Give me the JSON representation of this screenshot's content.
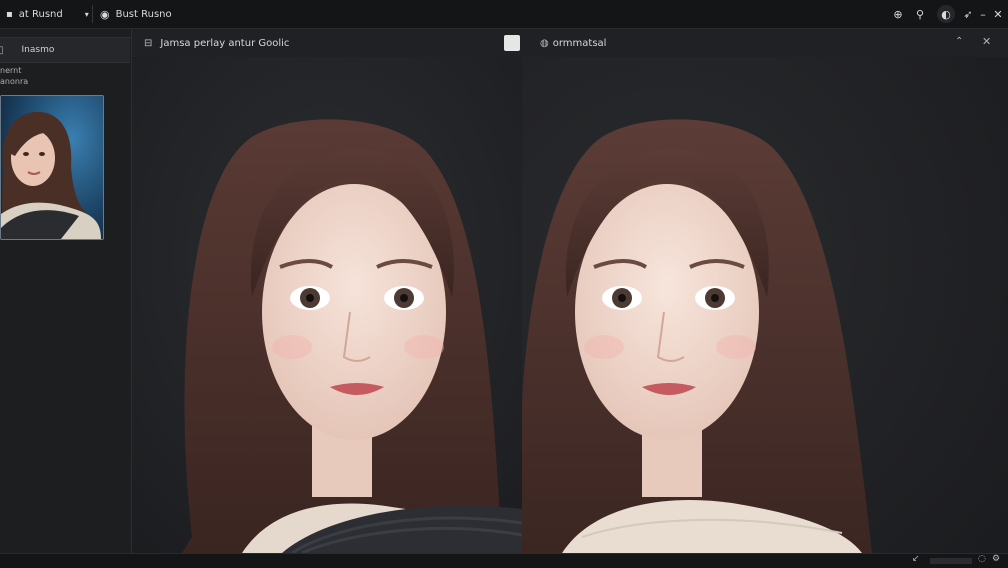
{
  "topbar": {
    "left_item": {
      "icon": "grid-icon",
      "label": "at Rusnd"
    },
    "second_item": {
      "icon": "circle-o-icon",
      "label": "Bust Rusno"
    },
    "right_icons": [
      "plus-circle-icon",
      "user-add-icon",
      "shield-icon",
      "send-icon",
      "minus-icon",
      "close-icon"
    ]
  },
  "sidebar": {
    "header_label": "Inasmo",
    "lines": [
      "nernt",
      "anonra"
    ],
    "thumbnail_alt": "portrait thumbnail"
  },
  "left_panel": {
    "title": "Jamsa perlay antur Goolic",
    "action_icon": "page-icon"
  },
  "right_panel": {
    "title": "ormmatsal",
    "collapse_icon": "chevron-up-icon",
    "close_icon": "close-icon"
  },
  "bottombar": {
    "icons": [
      "arrow-icon",
      "chat-icon",
      "sync-icon",
      "settings-icon"
    ]
  },
  "colors": {
    "background": "#1b1c1e",
    "topbar": "#141516",
    "panel_header": "#202124",
    "thumbnail_border": "#6b7a88"
  }
}
